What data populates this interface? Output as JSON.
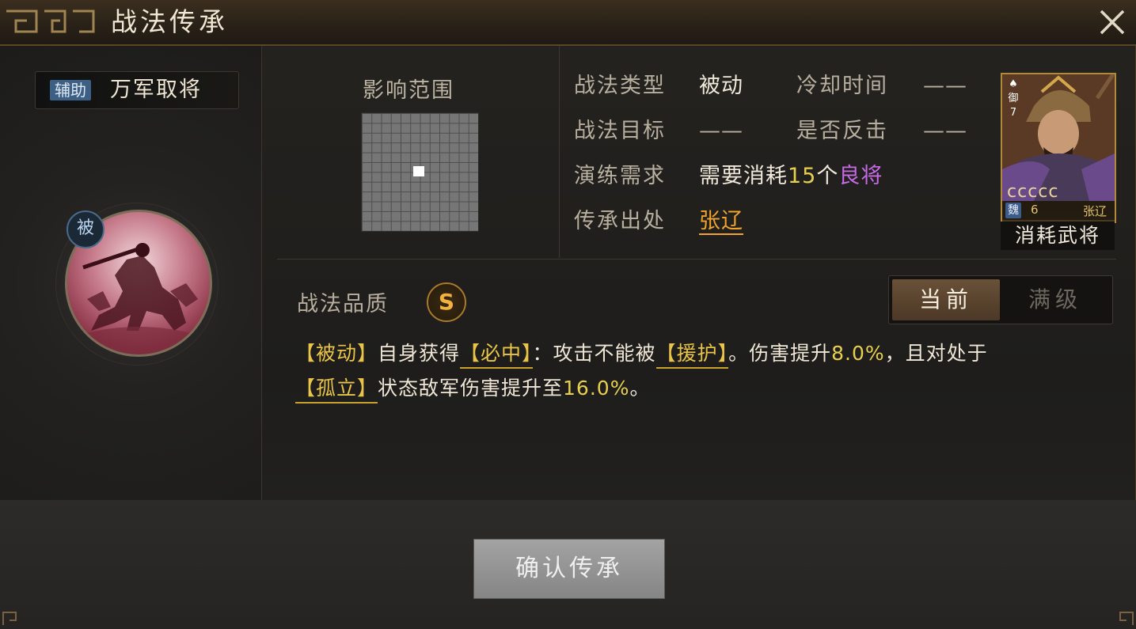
{
  "title": "战法传承",
  "tactic": {
    "badge": "辅助",
    "name": "万军取将",
    "passive_badge": "被"
  },
  "range": {
    "label": "影响范围"
  },
  "info": {
    "type_label": "战法类型",
    "type_value": "被动",
    "cooldown_label": "冷却时间",
    "cooldown_value": "——",
    "target_label": "战法目标",
    "target_value": "——",
    "counter_label": "是否反击",
    "counter_value": "——",
    "require_label": "演练需求",
    "require_prefix": "需要消耗",
    "require_count": "15",
    "require_unit": "个",
    "require_quality": "良将",
    "source_label": "传承出处",
    "source_value": "张辽"
  },
  "general_card": {
    "side_top": "御",
    "side_num": "7",
    "stars": "ccccc",
    "faction": "魏",
    "level": "6",
    "name": "张辽",
    "consume_label": "消耗武将"
  },
  "quality": {
    "label": "战法品质",
    "grade": "S"
  },
  "tabs": {
    "current": "当前",
    "max": "满级"
  },
  "description": {
    "kw_passive": "【被动】",
    "t1": "自身获得",
    "kw_hit": "【必中】",
    "t2": "：攻击不能被",
    "kw_guard": "【援护】",
    "t3": "。伤害提升",
    "pct1": "8.0%",
    "t4": "，且对处于",
    "kw_isolate": "【孤立】",
    "t5": "状态敌军伤害提升至",
    "pct2": "16.0%",
    "t6": "。"
  },
  "confirm_label": "确认传承",
  "colors": {
    "accent_gold": "#e9c446",
    "purple_quality": "#c66ae5",
    "orange_link": "#f0a42e"
  }
}
